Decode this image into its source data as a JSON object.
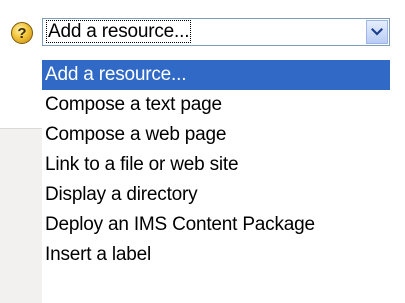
{
  "help_icon": {
    "name": "help-icon",
    "glyph": "?"
  },
  "select": {
    "value": "Add a resource...",
    "arrow_icon": "chevron-down-icon"
  },
  "dropdown": {
    "selected_index": 0,
    "options": [
      "Add a resource...",
      "Compose a text page",
      "Compose a web page",
      "Link to a file or web site",
      "Display a directory",
      "Deploy an IMS Content Package",
      "Insert a label"
    ]
  },
  "colors": {
    "highlight": "#3169c6",
    "select_border": "#7f9db9",
    "help_icon": "#f2c43a"
  }
}
